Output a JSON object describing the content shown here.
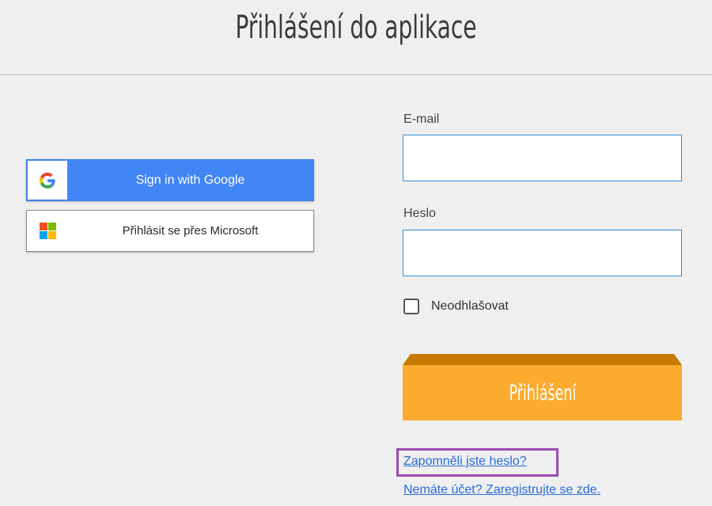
{
  "header": {
    "title": "Přihlášení do aplikace"
  },
  "social": {
    "google": {
      "label": "Sign in with Google",
      "icon": "google-g-icon"
    },
    "microsoft": {
      "label": "Přihlásit se přes Microsoft",
      "icon": "microsoft-logo-icon"
    }
  },
  "form": {
    "email": {
      "label": "E-mail",
      "value": "",
      "placeholder": ""
    },
    "password": {
      "label": "Heslo",
      "value": "",
      "placeholder": ""
    },
    "remember": {
      "label": "Neodhlašovat",
      "checked": false
    },
    "submit_label": "Přihlášení"
  },
  "links": {
    "forgot": "Zapomněli jste heslo?",
    "register": "Nemáte účet? Zaregistrujte se zde."
  },
  "colors": {
    "background": "#efefef",
    "google_blue": "#4285f4",
    "submit_orange": "#fcab2f",
    "submit_top": "#c77a00",
    "link": "#2a6bd6",
    "highlight": "#9c4bb0",
    "input_border": "#2f8fdc"
  }
}
